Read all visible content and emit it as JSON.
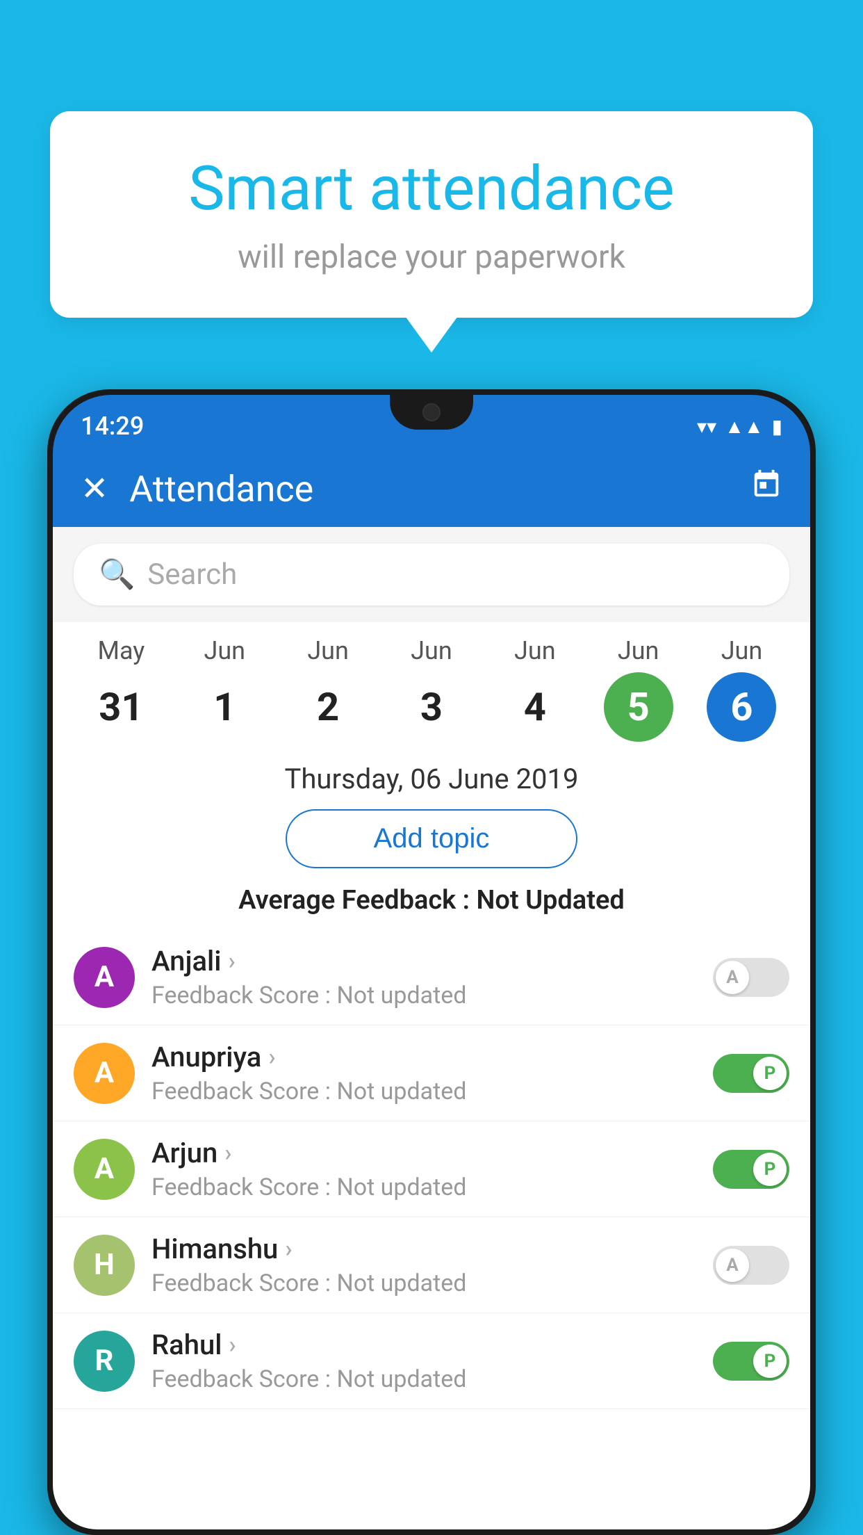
{
  "background_color": "#1ab8e8",
  "speech_bubble": {
    "title": "Smart attendance",
    "subtitle": "will replace your paperwork"
  },
  "status_bar": {
    "time": "14:29",
    "wifi": "▾",
    "signal": "▲",
    "battery": "▮"
  },
  "app_bar": {
    "title": "Attendance",
    "close_label": "✕",
    "calendar_icon": "📅"
  },
  "search": {
    "placeholder": "Search"
  },
  "calendar": {
    "days": [
      {
        "month": "May",
        "date": "31",
        "style": "normal"
      },
      {
        "month": "Jun",
        "date": "1",
        "style": "normal"
      },
      {
        "month": "Jun",
        "date": "2",
        "style": "normal"
      },
      {
        "month": "Jun",
        "date": "3",
        "style": "normal"
      },
      {
        "month": "Jun",
        "date": "4",
        "style": "normal"
      },
      {
        "month": "Jun",
        "date": "5",
        "style": "today"
      },
      {
        "month": "Jun",
        "date": "6",
        "style": "selected"
      }
    ]
  },
  "selected_date": "Thursday, 06 June 2019",
  "add_topic_label": "Add topic",
  "avg_feedback_label": "Average Feedback :",
  "avg_feedback_value": "Not Updated",
  "students": [
    {
      "name": "Anjali",
      "avatar_letter": "A",
      "avatar_color": "purple",
      "feedback": "Feedback Score : Not updated",
      "status": "absent"
    },
    {
      "name": "Anupriya",
      "avatar_letter": "A",
      "avatar_color": "orange",
      "feedback": "Feedback Score : Not updated",
      "status": "present"
    },
    {
      "name": "Arjun",
      "avatar_letter": "A",
      "avatar_color": "green",
      "feedback": "Feedback Score : Not updated",
      "status": "present"
    },
    {
      "name": "Himanshu",
      "avatar_letter": "H",
      "avatar_color": "light-green",
      "feedback": "Feedback Score : Not updated",
      "status": "absent"
    },
    {
      "name": "Rahul",
      "avatar_letter": "R",
      "avatar_color": "teal",
      "feedback": "Feedback Score : Not updated",
      "status": "present"
    }
  ]
}
